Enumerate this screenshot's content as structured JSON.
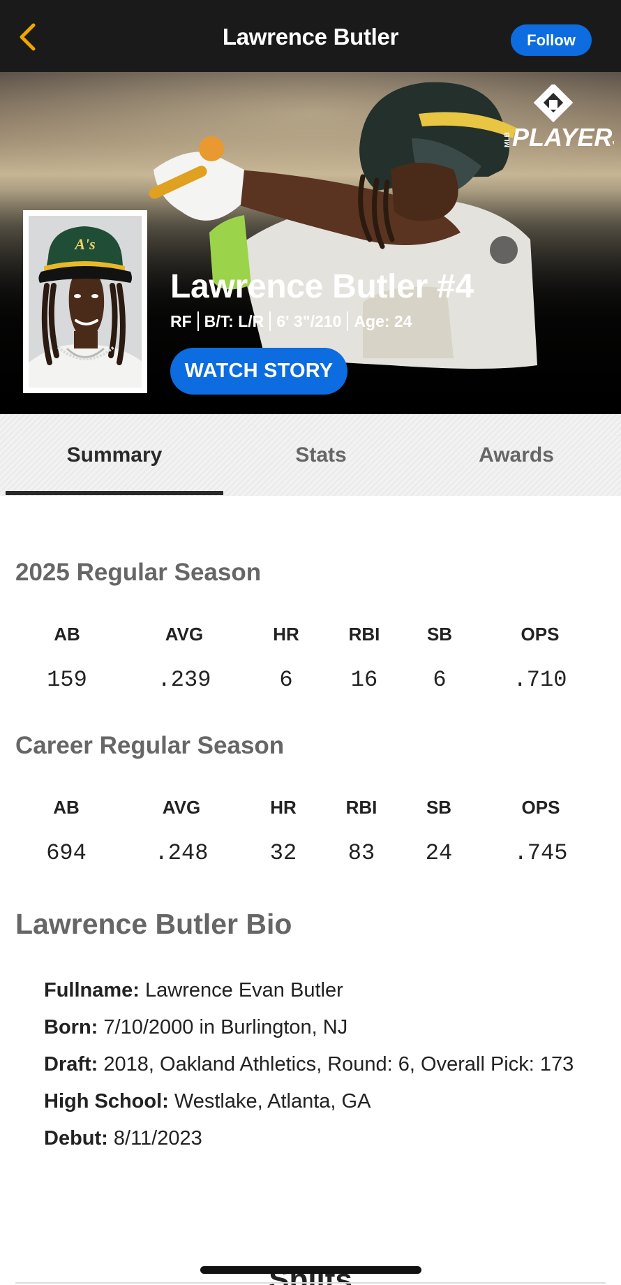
{
  "nav": {
    "title": "Lawrence Butler",
    "follow_label": "Follow"
  },
  "hero": {
    "logo_text": "PLAYERS",
    "logo_small": "MLB",
    "name": "Lawrence Butler #4",
    "position": "RF",
    "bats_throws": "B/T: L/R",
    "height_weight": "6' 3\"/210",
    "age": "Age: 24",
    "watch_label": "WATCH STORY",
    "cap_logo": "A's"
  },
  "tabs": [
    {
      "label": "Summary",
      "active": true
    },
    {
      "label": "Stats",
      "active": false
    },
    {
      "label": "Awards",
      "active": false
    }
  ],
  "season": {
    "title": "2025 Regular Season",
    "headers": [
      "AB",
      "AVG",
      "HR",
      "RBI",
      "SB",
      "OPS"
    ],
    "values": [
      "159",
      ".239",
      "6",
      "16",
      "6",
      ".710"
    ]
  },
  "career": {
    "title": "Career Regular Season",
    "headers": [
      "AB",
      "AVG",
      "HR",
      "RBI",
      "SB",
      "OPS"
    ],
    "values": [
      "694",
      ".248",
      "32",
      "83",
      "24",
      ".745"
    ]
  },
  "bio": {
    "title": "Lawrence Butler Bio",
    "items": [
      {
        "label": "Fullname:",
        "value": " Lawrence Evan Butler"
      },
      {
        "label": "Born:",
        "value": " 7/10/2000 in Burlington, NJ"
      },
      {
        "label": "Draft:",
        "value": " 2018, Oakland Athletics, Round: 6, Overall Pick: 173"
      },
      {
        "label": "High School:",
        "value": " Westlake, Atlanta, GA"
      },
      {
        "label": "Debut:",
        "value": " 8/11/2023"
      }
    ]
  },
  "splits_title": "Splits",
  "colors": {
    "accent_blue": "#0c6ce0",
    "back_arrow": "#f0a500",
    "navbar": "#1a1a1a"
  },
  "icons": {
    "back": "chevron-left-icon",
    "logo": "mlb-players-logo"
  }
}
